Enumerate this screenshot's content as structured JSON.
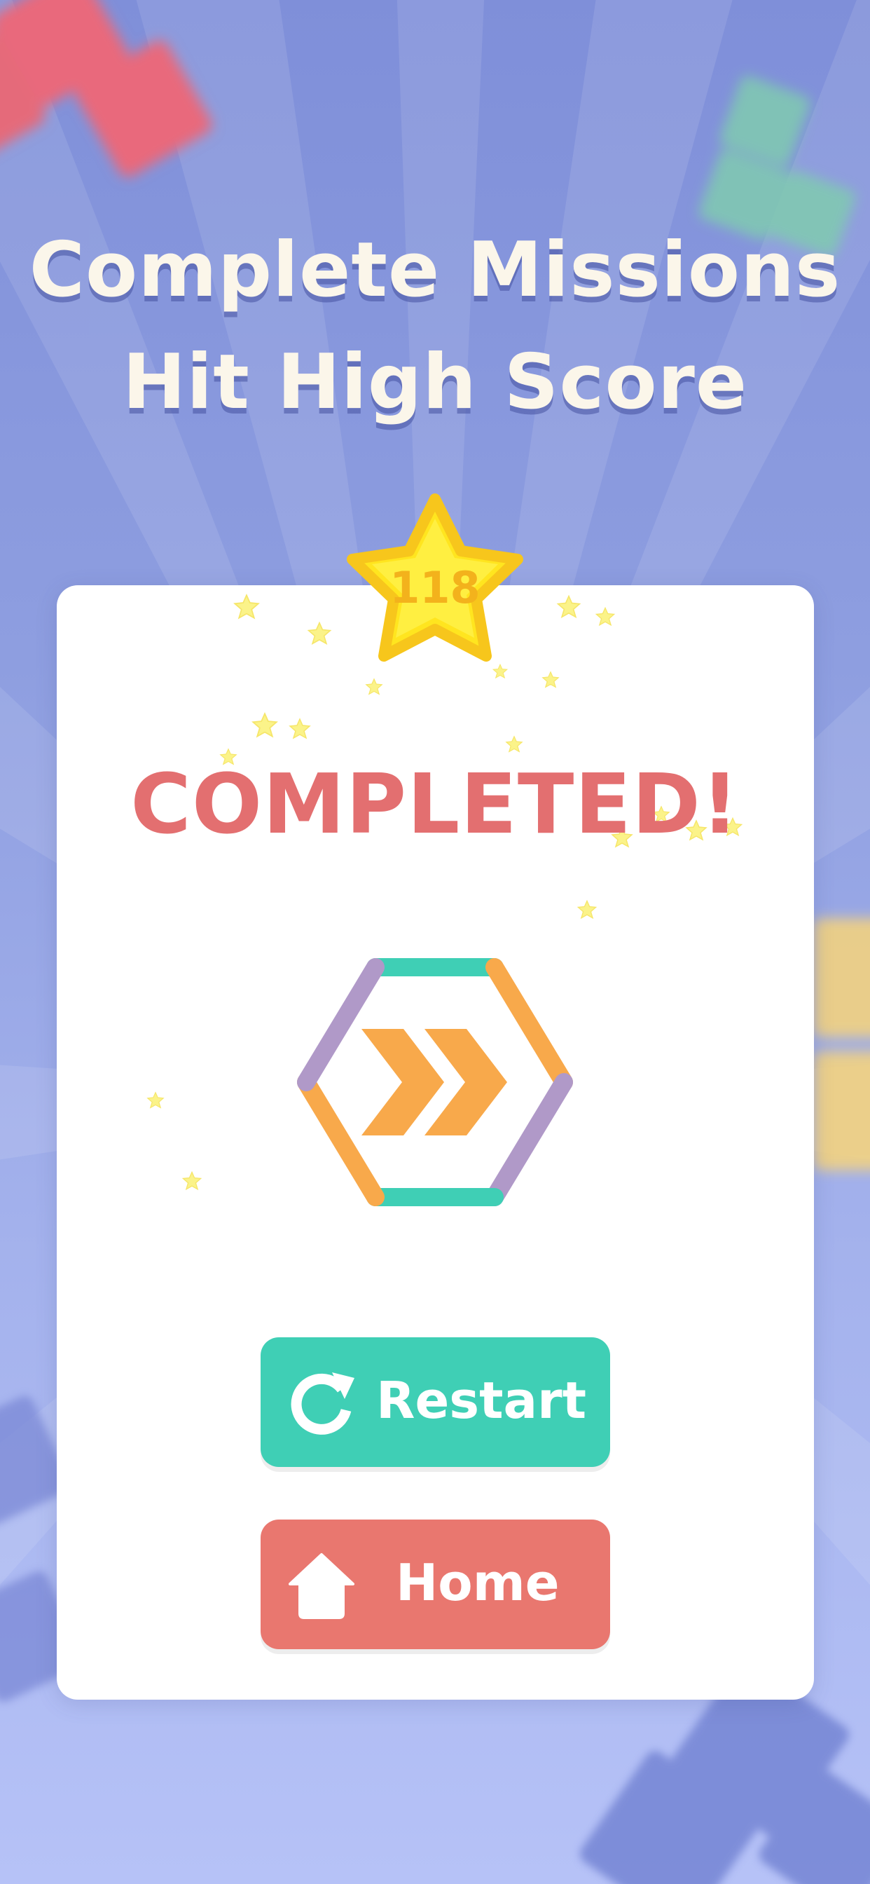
{
  "headline": {
    "line1": "Complete Missions",
    "line2": "Hit High Score"
  },
  "result": {
    "score": "118",
    "status": "COMPLETED!"
  },
  "mission_icon": "double-chevron-forward-hexagon-icon",
  "buttons": {
    "restart": {
      "label": "Restart",
      "icon": "restart-icon"
    },
    "home": {
      "label": "Home",
      "icon": "home-icon"
    }
  },
  "colors": {
    "background_top": "#7f8fd9",
    "background_bottom": "#b6c2f7",
    "headline_text": "#fbf6ea",
    "completed_text": "#e36f70",
    "star_fill": "#ffe51f",
    "star_outline": "#f7c61c",
    "restart_button": "#3fcfb5",
    "home_button": "#e9776f",
    "hexagon_orange": "#f8a94b",
    "hexagon_teal": "#3fcfb5",
    "hexagon_purple": "#b099c8"
  }
}
